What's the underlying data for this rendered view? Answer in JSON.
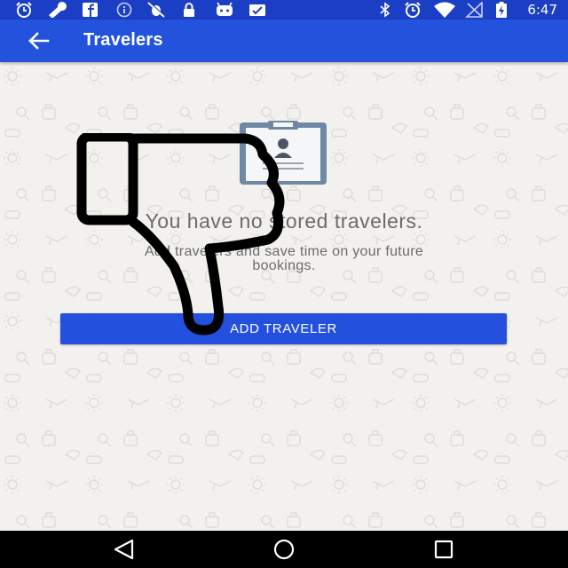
{
  "status_bar": {
    "time": "6:47",
    "left_icons": [
      "alarm-icon",
      "wrench-icon",
      "facebook-icon",
      "info-icon",
      "no-bug-icon",
      "lock-icon",
      "android-icon",
      "checklist-icon"
    ],
    "right_icons": [
      "bluetooth-icon",
      "alarm-icon",
      "wifi-icon",
      "no-signal-icon",
      "battery-charging-icon"
    ]
  },
  "app_bar": {
    "back_icon": "arrow-back-icon",
    "title": "Travelers"
  },
  "empty_state": {
    "illustration": "clipboard-traveler-icon",
    "title": "You have no stored travelers.",
    "subtitle_line1": "Add travelers and save time on your future",
    "subtitle_line2": "bookings.",
    "button_label": "ADD TRAVELER"
  },
  "overlay": {
    "icon": "thumbs-down-icon"
  },
  "nav_bar": {
    "icons": [
      "back-triangle-icon",
      "home-circle-icon",
      "recents-square-icon"
    ]
  },
  "colors": {
    "status_bar": "#1b3fc4",
    "app_bar": "#2352dc",
    "button": "#2450de",
    "background": "#f2f1ee",
    "text_muted": "#6b6b6b"
  }
}
